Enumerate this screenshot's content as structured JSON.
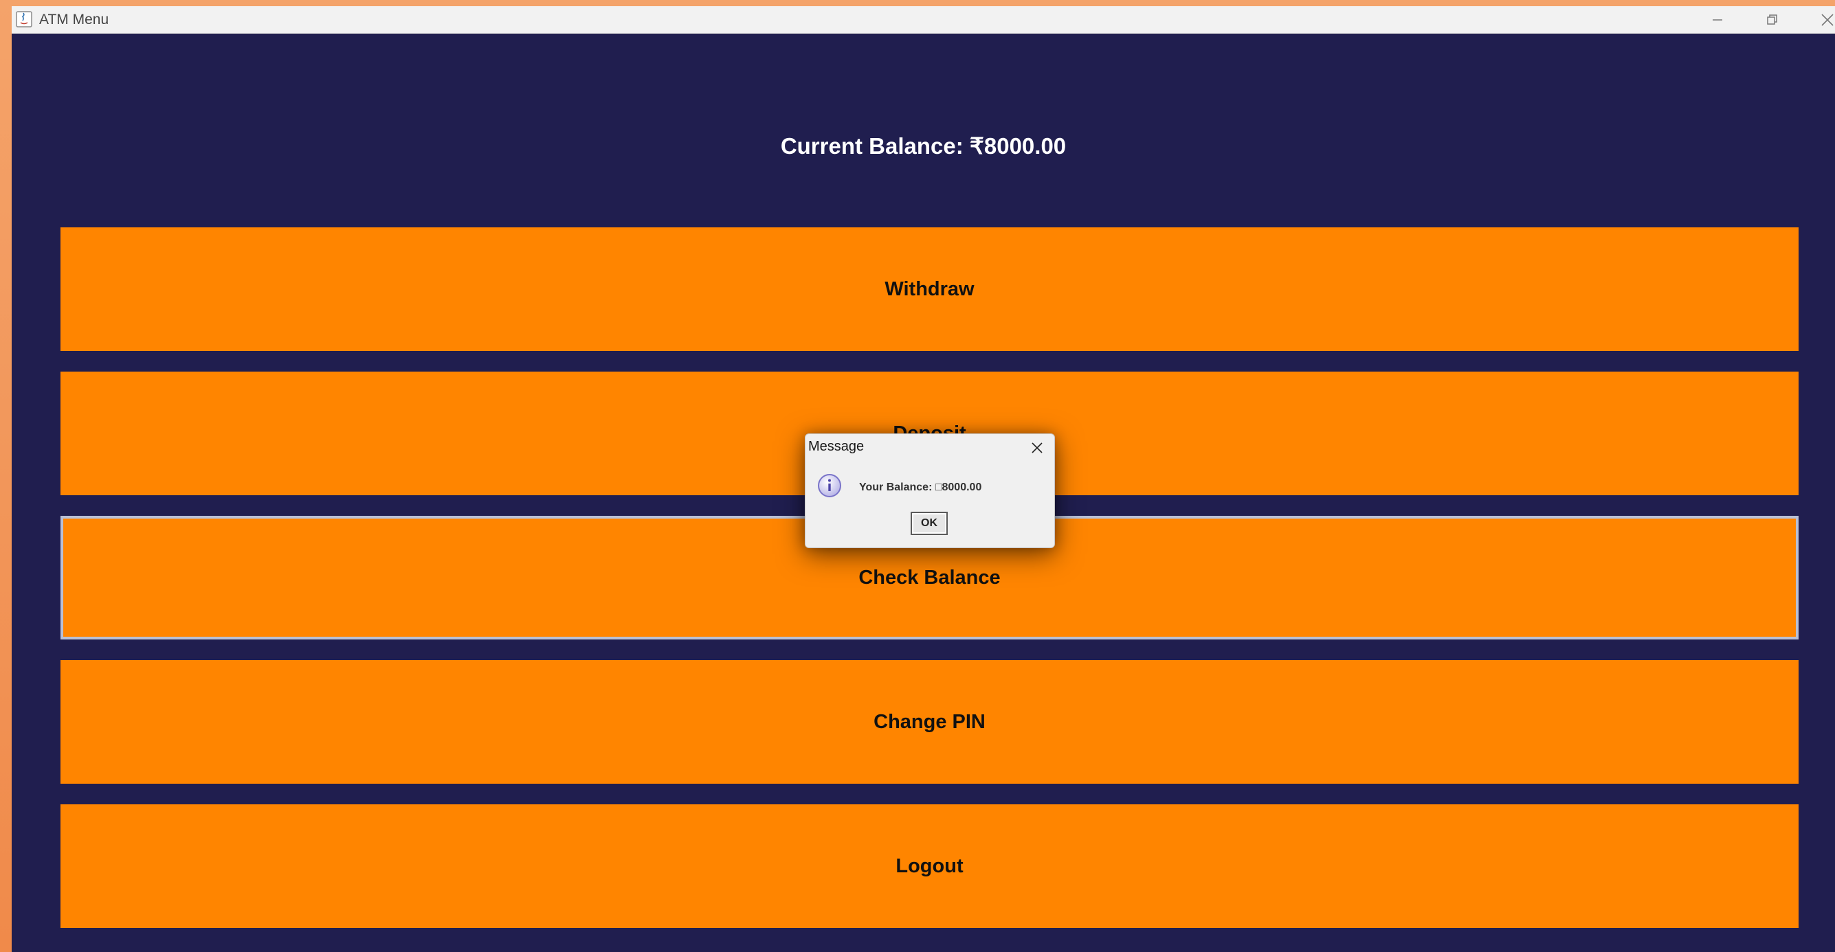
{
  "window": {
    "title": "ATM Menu",
    "minimize_icon": "minimize-icon",
    "maximize_icon": "restore-icon",
    "close_icon": "close-icon"
  },
  "main": {
    "balance_text": "Current Balance: ₹8000.00",
    "buttons": [
      {
        "label": "Withdraw"
      },
      {
        "label": "Deposit"
      },
      {
        "label": "Check Balance"
      },
      {
        "label": "Change PIN"
      },
      {
        "label": "Logout"
      }
    ]
  },
  "dialog": {
    "title": "Message",
    "message": "Your Balance: □8000.00",
    "ok_label": "OK",
    "icon": "info-icon"
  },
  "colors": {
    "background": "#201e4f",
    "button": "#ff8500",
    "text": "#ffffff"
  }
}
